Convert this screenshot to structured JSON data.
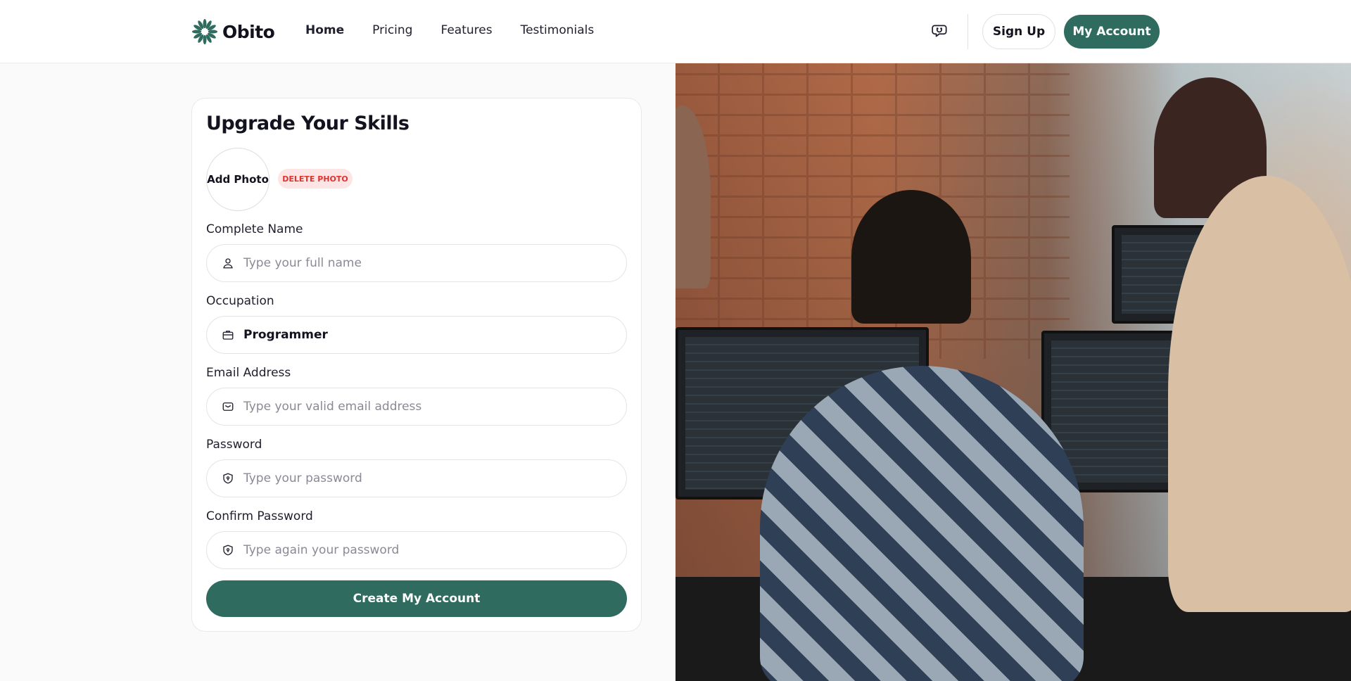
{
  "brand": {
    "name": "Obito",
    "accent": "#2f6b5e"
  },
  "nav": {
    "links": [
      {
        "label": "Home",
        "active": true
      },
      {
        "label": "Pricing",
        "active": false
      },
      {
        "label": "Features",
        "active": false
      },
      {
        "label": "Testimonials",
        "active": false
      }
    ],
    "support_icon": "chat-support-icon",
    "signup_label": "Sign Up",
    "account_label": "My Account"
  },
  "form": {
    "title": "Upgrade Your Skills",
    "add_photo_label": "Add Photo",
    "delete_photo_label": "DELETE PHOTO",
    "fields": [
      {
        "label": "Complete Name",
        "icon": "user-icon",
        "placeholder": "Type your full name",
        "value": ""
      },
      {
        "label": "Occupation",
        "icon": "briefcase-icon",
        "placeholder": "",
        "value": "Programmer"
      },
      {
        "label": "Email Address",
        "icon": "mail-icon",
        "placeholder": "Type your valid email address",
        "value": ""
      },
      {
        "label": "Password",
        "icon": "shield-lock-icon",
        "placeholder": "Type your password",
        "value": ""
      },
      {
        "label": "Confirm Password",
        "icon": "shield-lock-icon",
        "placeholder": "Type again your password",
        "value": ""
      }
    ],
    "submit_label": "Create My Account"
  }
}
